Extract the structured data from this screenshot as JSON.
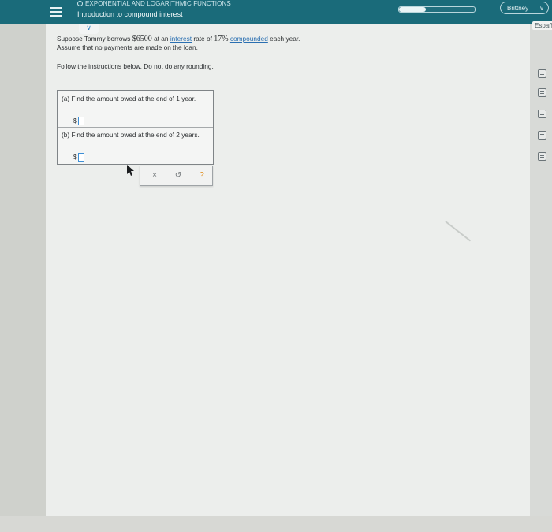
{
  "header": {
    "category": "EXPONENTIAL AND LOGARITHMIC FUNCTIONS",
    "topic": "Introduction to compound interest",
    "progress_fraction": 0.35,
    "user_name": "Brittney",
    "language_link": "Españ"
  },
  "problem": {
    "line1_pre": "Suppose Tammy borrows ",
    "principal": "$6500",
    "line1_mid": " at an ",
    "interest_link": "interest",
    "line1_mid2": " rate of ",
    "rate": "17%",
    "line1_mid3": " ",
    "compounded_link": "compounded",
    "line1_post": " each year.",
    "line2": "Assume that no payments are made on the loan.",
    "instructions": "Follow the instructions below. Do not do any rounding."
  },
  "parts": {
    "a": {
      "prompt": "(a) Find the amount owed at the end of 1 year.",
      "currency": "$",
      "value": ""
    },
    "b": {
      "prompt": "(b) Find the amount owed at the end of 2 years.",
      "currency": "$",
      "value": ""
    }
  },
  "actions": {
    "clear": "×",
    "undo": "↺",
    "help": "?"
  },
  "colors": {
    "header": "#1a6b7a",
    "link": "#2a6fb1",
    "help": "#e08c1b"
  },
  "icons": [
    "menu-icon",
    "chevron-down-icon",
    "calculator-icon",
    "video-icon",
    "book-icon",
    "notes-icon",
    "mail-icon"
  ]
}
